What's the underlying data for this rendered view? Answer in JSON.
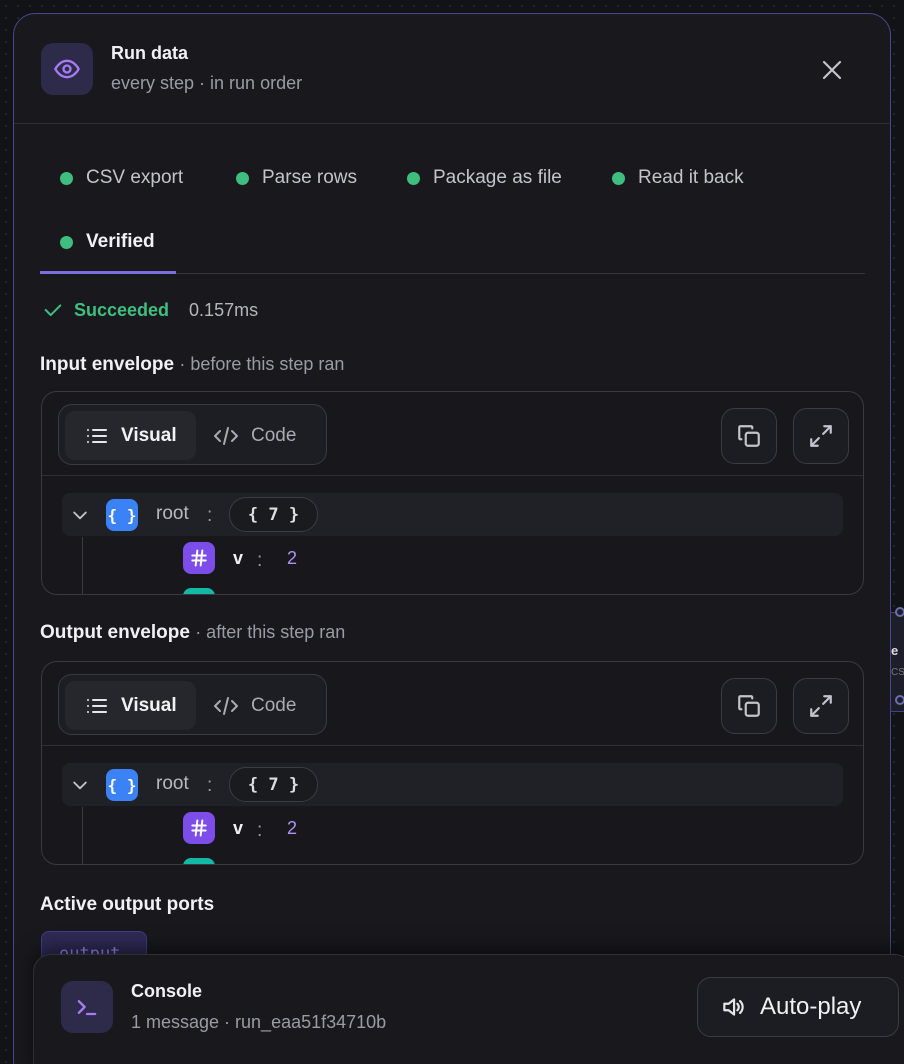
{
  "panel": {
    "title": "Run data",
    "subtitle": "every step · in run order"
  },
  "tabs": [
    {
      "label": "CSV export",
      "status": "success"
    },
    {
      "label": "Parse rows",
      "status": "success"
    },
    {
      "label": "Package as file",
      "status": "success"
    },
    {
      "label": "Read it back",
      "status": "success"
    },
    {
      "label": "Verified",
      "status": "success",
      "active": true
    }
  ],
  "status": {
    "label": "Succeeded",
    "duration": "0.157ms"
  },
  "input": {
    "title": "Input envelope",
    "meta": "· before this step ran",
    "view_visual": "Visual",
    "view_code": "Code",
    "root_key": "root",
    "root_count": "{ 7 }",
    "child_key": "v",
    "child_value": "2"
  },
  "output": {
    "title": "Output envelope",
    "meta": "· after this step ran",
    "view_visual": "Visual",
    "view_code": "Code",
    "root_key": "root",
    "root_count": "{ 7 }",
    "child_key": "v",
    "child_value": "2"
  },
  "ports": {
    "title": "Active output ports",
    "items": [
      "output"
    ]
  },
  "console": {
    "title": "Console",
    "subtitle": "1 message · run_eaa51f34710b",
    "autoplay_label": "Auto-play"
  },
  "colors": {
    "accent": "#7d6ee0",
    "success": "#3fbf7f",
    "object_badge": "#3b82f6",
    "number_badge": "#7c4de8"
  }
}
